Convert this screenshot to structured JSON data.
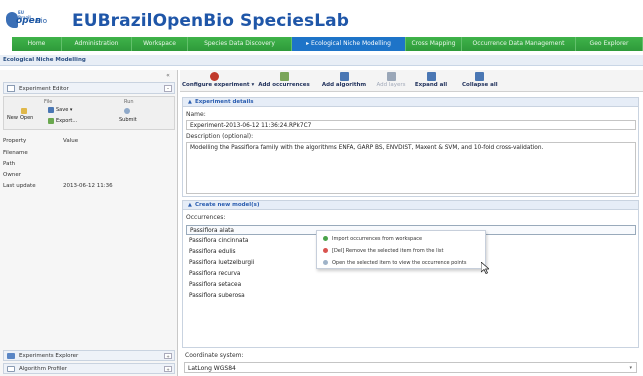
{
  "header": {
    "logo_small": "EU Brazil",
    "logo_main": "open",
    "logo_suffix": "Bio",
    "title": "EUBrazilOpenBio SpeciesLab"
  },
  "nav": {
    "tabs": [
      {
        "label": "Home",
        "active": false
      },
      {
        "label": "Administration",
        "active": false
      },
      {
        "label": "Workspace",
        "active": false
      },
      {
        "label": "Species Data Discovery",
        "active": false
      },
      {
        "label": "▸ Ecological Niche Modelling",
        "active": true
      },
      {
        "label": "Cross Mapping",
        "active": false
      },
      {
        "label": "Occurrence Data Management",
        "active": false
      },
      {
        "label": "Geo Explorer",
        "active": false
      }
    ]
  },
  "section": {
    "title": "Ecological Niche Modelling"
  },
  "left": {
    "collapse": "«",
    "editor_title": "Experiment Editor",
    "editor_btn": "–",
    "groups": {
      "file": "File",
      "run": "Run"
    },
    "tools": {
      "new": "New",
      "open": "Open",
      "save": "Save ▾",
      "export": "Export...",
      "submit": "Submit"
    },
    "props_header": {
      "k": "Property",
      "v": "Value"
    },
    "props": [
      {
        "k": "Filename",
        "v": ""
      },
      {
        "k": "Path",
        "v": ""
      },
      {
        "k": "Owner",
        "v": ""
      },
      {
        "k": "Last update",
        "v": "2013-06-12 11:36"
      }
    ],
    "bottom": [
      {
        "label": "Experiments Explorer",
        "btn": "+"
      },
      {
        "label": "Algorithm Profiler",
        "btn": "+"
      }
    ]
  },
  "toolbar": {
    "buttons": [
      {
        "label": "Configure experiment",
        "suffix": "▾",
        "color": "#c0392b",
        "disabled": false
      },
      {
        "label": "Add occurrences",
        "color": "#7aa65a",
        "disabled": false
      },
      {
        "label": "Add algorithm",
        "color": "#4a77b4",
        "disabled": false
      },
      {
        "label": "Add layers",
        "color": "#9aa7b8",
        "disabled": true
      },
      {
        "label": "Expand all",
        "color": "#4a77b4",
        "disabled": false
      },
      {
        "label": "Collapse all",
        "color": "#4a77b4",
        "disabled": false
      }
    ]
  },
  "details": {
    "toggle": "▲",
    "title": "Experiment details",
    "name_label": "Name:",
    "name_value": "Experiment-2013-06-12 11:36:24.RPk7C7",
    "desc_label": "Description (optional):",
    "desc_value": "Modelling the Passiflora family with the algorithms ENFA, GARP BS, ENVDIST, Maxent & SVM, and 10-fold cross-validation."
  },
  "model": {
    "toggle": "▲",
    "title": "Create new model(s)",
    "occ_label": "Occurrences:",
    "occurrences": [
      "Passiflora alata",
      "Passiflora cincinnata",
      "Passiflora edulis",
      "Passiflora luetzelburgii",
      "Passiflora recurva",
      "Passiflora setacea",
      "Passiflora suberosa"
    ]
  },
  "context_menu": {
    "items": [
      {
        "label": "Import occurrences from workspace",
        "color": "#4aa34a"
      },
      {
        "label": "[Del] Remove the selected item from the list",
        "color": "#d9534f"
      },
      {
        "label": "Open the selected item to view the occurrence points",
        "color": "#9fb3c8"
      }
    ]
  },
  "coord": {
    "label": "Coordinate system:",
    "value": "LatLong WGS84",
    "arrow": "▾"
  }
}
